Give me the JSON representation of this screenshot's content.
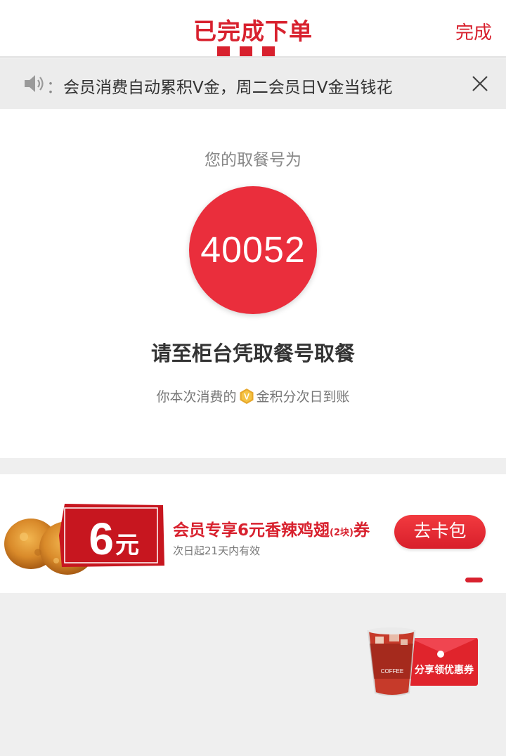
{
  "header": {
    "title": "已完成下单",
    "done_label": "完成"
  },
  "notice": {
    "separator": "：",
    "text": "会员消费自动累积V金，周二会员日V金当钱花"
  },
  "pickup": {
    "label": "您的取餐号为",
    "number": "40052",
    "instruction": "请至柜台凭取餐号取餐",
    "points_before": "你本次消费的",
    "coin_letter": "V",
    "points_after": "金积分次日到账"
  },
  "coupon": {
    "amount": "6",
    "unit": "元",
    "title_main": "会员专享6元香辣鸡翅",
    "title_small": "(2块)",
    "title_suffix": "券",
    "validity": "次日起21天内有效",
    "button_label": "去卡包"
  },
  "share": {
    "label": "分享领优惠券",
    "cup_text": "COFFEE"
  },
  "colors": {
    "brand_red": "#d8212e",
    "circle_red": "#ea2e3c",
    "gold": "#e7a82c"
  }
}
